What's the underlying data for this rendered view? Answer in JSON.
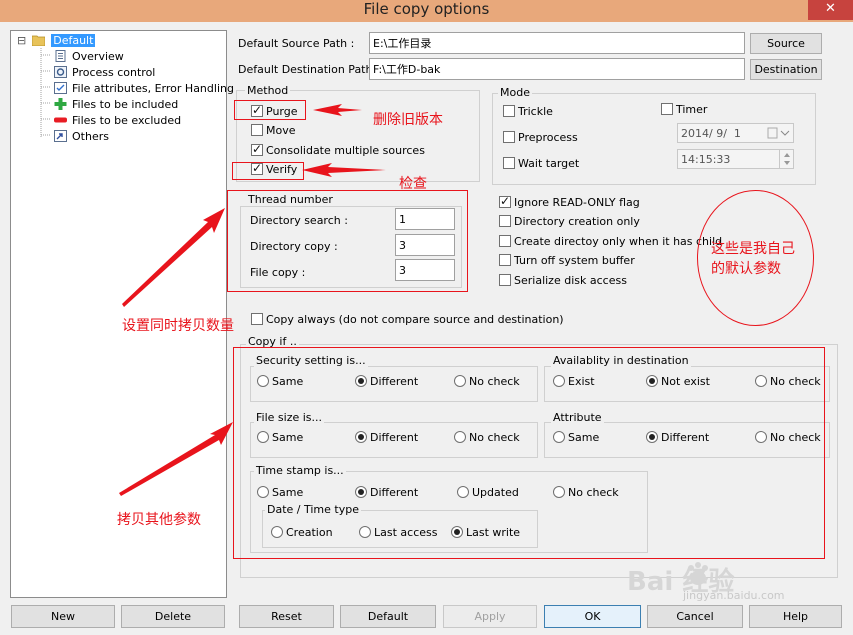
{
  "window": {
    "title": "File copy options",
    "close": "✕"
  },
  "tree": {
    "root": "Default",
    "expander": "⊟",
    "items": [
      "Overview",
      "Process control",
      "File attributes, Error Handling",
      "Files to be included",
      "Files to be excluded",
      "Others"
    ]
  },
  "paths": {
    "source_label": "Default Source Path :",
    "source_value": "E:\\工作目录",
    "source_button": "Source",
    "dest_label": "Default Destination Path :",
    "dest_value": "F:\\工作D-bak",
    "dest_button": "Destination"
  },
  "method": {
    "title": "Method",
    "purge": "Purge",
    "move": "Move",
    "consolidate": "Consolidate multiple sources",
    "verify": "Verify"
  },
  "mode": {
    "title": "Mode",
    "trickle": "Trickle",
    "timer": "Timer",
    "preprocess": "Preprocess",
    "wait_target": "Wait target",
    "date": "2014/ 9/  1",
    "time": "14:15:33"
  },
  "thread": {
    "title": "Thread number",
    "dir_search_label": "Directory search :",
    "dir_search_value": "1",
    "dir_copy_label": "Directory copy :",
    "dir_copy_value": "3",
    "file_copy_label": "File copy :",
    "file_copy_value": "3"
  },
  "flags": {
    "ignore_readonly": "Ignore READ-ONLY flag",
    "dir_creation_only": "Directory creation only",
    "create_dir_child": "Create directoy only when it has child",
    "turn_off_buffer": "Turn off system buffer",
    "serialize": "Serialize disk access"
  },
  "copy_always": "Copy always (do not compare source and destination)",
  "copy_if": {
    "title": "Copy if ..",
    "security": {
      "title": "Security setting is...",
      "options": [
        "Same",
        "Different",
        "No check"
      ]
    },
    "availability": {
      "title": "Availablity in destination",
      "options": [
        "Exist",
        "Not exist",
        "No check"
      ]
    },
    "filesize": {
      "title": "File size is...",
      "options": [
        "Same",
        "Different",
        "No check"
      ]
    },
    "attribute": {
      "title": "Attribute",
      "options": [
        "Same",
        "Different",
        "No check"
      ]
    },
    "timestamp": {
      "title": "Time stamp is...",
      "options": [
        "Same",
        "Different",
        "Updated",
        "No check"
      ]
    },
    "datetype": {
      "title": "Date / Time type",
      "options": [
        "Creation",
        "Last access",
        "Last write"
      ]
    }
  },
  "buttons": {
    "new": "New",
    "delete": "Delete",
    "reset": "Reset",
    "default": "Default",
    "apply": "Apply",
    "ok": "OK",
    "cancel": "Cancel",
    "help": "Help"
  },
  "annotations": {
    "purge_note": "删除旧版本",
    "verify_note": "检查",
    "thread_note": "设置同时拷贝数量",
    "defaults_note_1": "这些是我自己",
    "defaults_note_2": "的默认参数",
    "copy_note": "拷贝其他参数"
  },
  "watermark": {
    "logo": "Bai  经验",
    "url": "jingyan.baidu.com"
  },
  "colors": {
    "annotation_red": "#e8141c",
    "selection_blue": "#3399ff",
    "titlebar": "#e8a87b"
  }
}
